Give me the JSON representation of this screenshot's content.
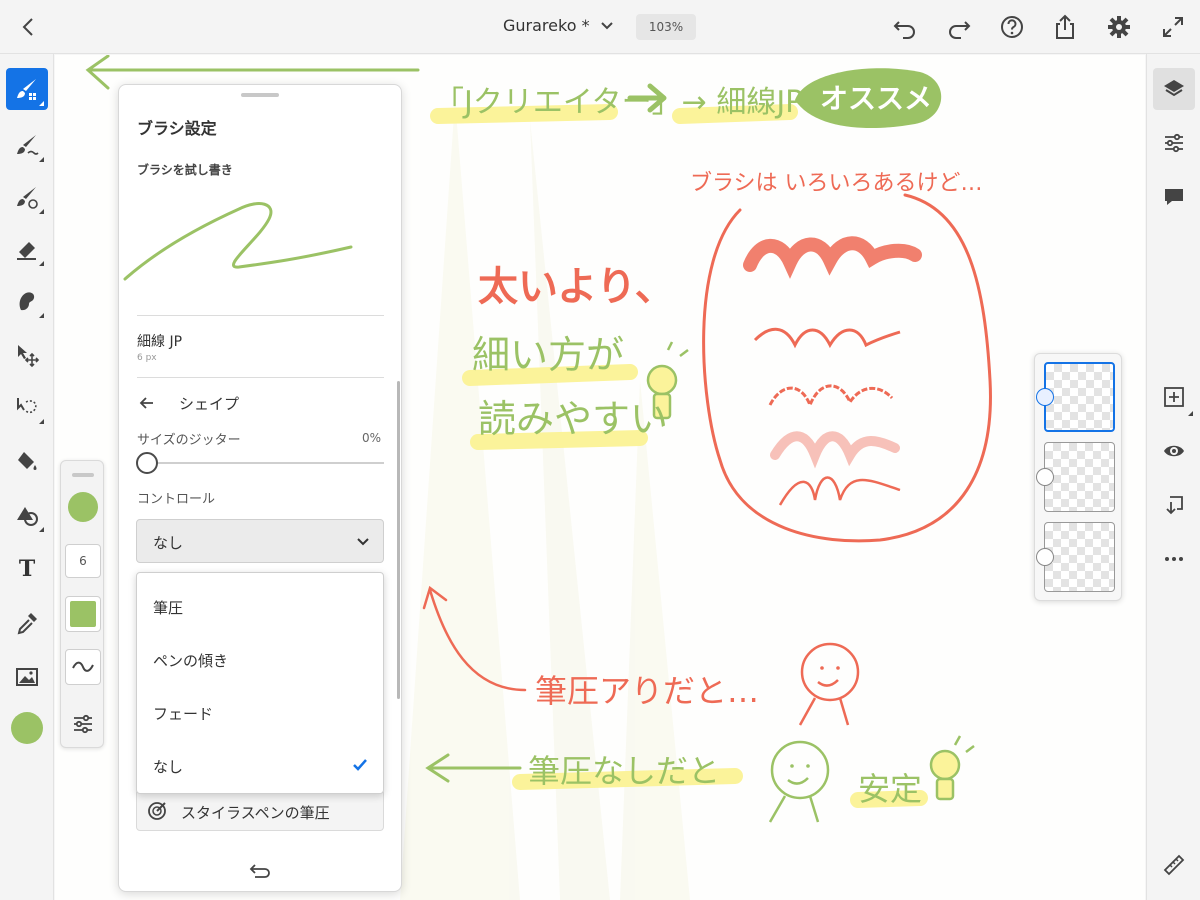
{
  "app": {
    "document_title": "Gurareko *",
    "zoom": "103%"
  },
  "icons": {
    "top_left": [
      "back-chevron-icon"
    ],
    "top_right": [
      "undo-icon",
      "redo-icon",
      "help-icon",
      "share-icon",
      "settings-gear-icon",
      "fullscreen-icon"
    ],
    "left_tools": [
      "pixel-brush-icon",
      "live-brush-icon",
      "vector-brush-icon",
      "eraser-icon",
      "smudge-icon",
      "transform-icon",
      "lasso-select-icon",
      "fill-bucket-icon",
      "shapes-icon",
      "text-icon",
      "eyedropper-icon",
      "place-image-icon"
    ],
    "right_tools": [
      "layers-icon",
      "layer-properties-icon",
      "comments-icon",
      "add-layer-icon",
      "visibility-eye-icon",
      "merge-down-icon",
      "more-icon",
      "ruler-icon"
    ]
  },
  "colors": {
    "accent": "#1473e6",
    "brush_color": "#9bc265",
    "ink_red": "#ee6a55",
    "highlight_yellow": "#fbf39a"
  },
  "quick_panel": {
    "brush_size": "6"
  },
  "brush_settings": {
    "title": "ブラシ設定",
    "test_label": "ブラシを試し書き",
    "brush_name": "細線 JP",
    "brush_size": "6 px",
    "section": "シェイプ",
    "size_jitter_label": "サイズのジッター",
    "size_jitter_value": "0%",
    "size_jitter_fraction": 0.0,
    "control_label": "コントロール",
    "control_value": "なし",
    "control_options": [
      {
        "label": "筆圧",
        "selected": false
      },
      {
        "label": "ペンの傾き",
        "selected": false
      },
      {
        "label": "フェード",
        "selected": false
      },
      {
        "label": "なし",
        "selected": true
      }
    ],
    "stylus_pressure_label": "スタイラスペンの筆圧"
  },
  "canvas_text": {
    "recommend_line": "「Jクリエイター」→ 細線JP",
    "recommend_badge": "オススメ",
    "many_brushes": "ブラシは いろいろあるけど…",
    "thin_over_thick_1": "太いより、",
    "thin_over_thick_2": "細い方が",
    "thin_over_thick_3": "読みやすい",
    "with_pressure": "筆圧アりだと…",
    "without_pressure": "筆圧なしだと",
    "stable": "安定"
  },
  "layers": {
    "count": 3,
    "selected_index": 0
  }
}
